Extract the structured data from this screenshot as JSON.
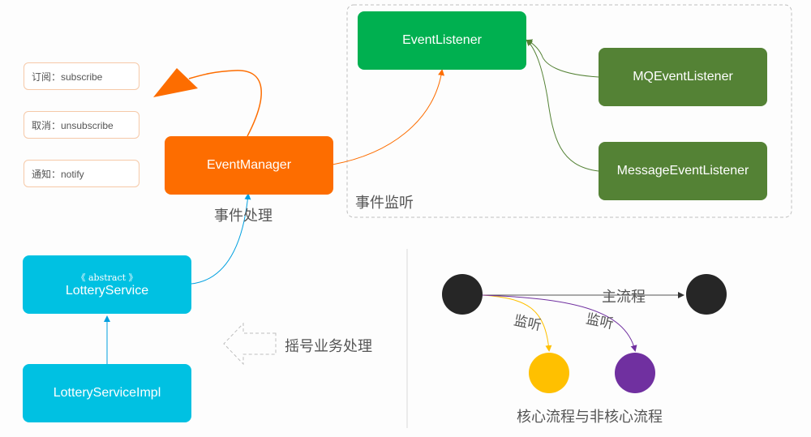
{
  "colors": {
    "orange": "#fd6d00",
    "green_bright": "#00b050",
    "green_dark": "#548235",
    "cyan": "#00c1e2",
    "dark_node": "#262626",
    "yellow_node": "#ffc000",
    "purple_node": "#7030a0",
    "dashed_border": "#bfbfbf"
  },
  "operations": [
    {
      "label": "订阅：subscribe"
    },
    {
      "label": "取消：unsubscribe"
    },
    {
      "label": "通知：notify"
    }
  ],
  "event_manager": {
    "title": "EventManager",
    "caption": "事件处理"
  },
  "listener_group": {
    "caption": "事件监听",
    "base": "EventListener",
    "impls": [
      "MQEventListener",
      "MessageEventListener"
    ]
  },
  "lottery": {
    "stereotype": "《 abstract 》",
    "abstract_name": "LotteryService",
    "impl_name": "LotteryServiceImpl",
    "arrow_caption": "摇号业务处理"
  },
  "flow": {
    "main_label": "主流程",
    "listen_label_1": "监听",
    "listen_label_2": "监听",
    "caption": "核心流程与非核心流程"
  }
}
